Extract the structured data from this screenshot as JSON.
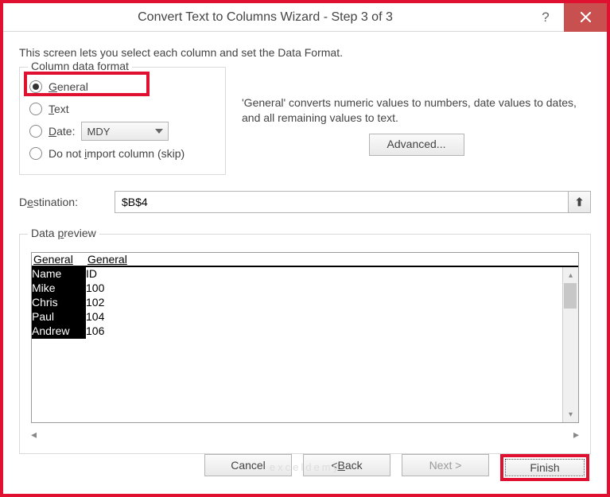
{
  "title": "Convert Text to Columns Wizard - Step 3 of 3",
  "intro": "This screen lets you select each column and set the Data Format.",
  "format": {
    "legend": "Column data format",
    "general": "General",
    "text": "Text",
    "date": "Date:",
    "date_value": "MDY",
    "skip": "Do not import column (skip)"
  },
  "explain": "'General' converts numeric values to numbers, date values to dates, and all remaining values to text.",
  "advanced": "Advanced...",
  "destination_label": "Destination:",
  "destination_value": "$B$4",
  "preview": {
    "legend": "Data preview",
    "headers": [
      "General",
      "General"
    ],
    "rows": [
      [
        "Name",
        "ID"
      ],
      [
        "Mike",
        "100"
      ],
      [
        "Chris",
        "102"
      ],
      [
        "Paul",
        "104"
      ],
      [
        "Andrew",
        "106"
      ]
    ]
  },
  "buttons": {
    "cancel": "Cancel",
    "back": "< Back",
    "next": "Next >",
    "finish": "Finish"
  },
  "watermark": "exceldemy"
}
